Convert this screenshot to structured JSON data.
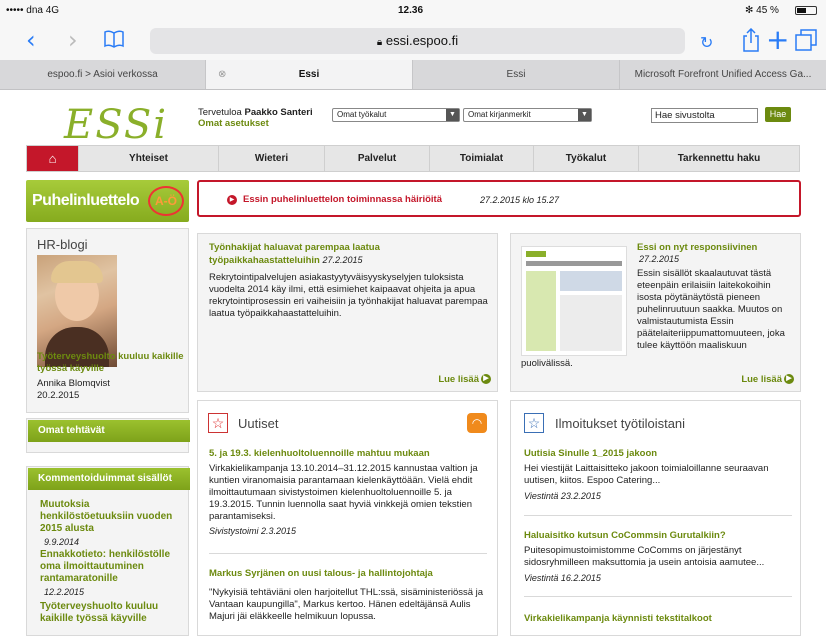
{
  "status": {
    "carrier": "••••• dna  4G",
    "time": "12.36",
    "battery": "✻ 45 %"
  },
  "browser": {
    "url": "essi.espoo.fi",
    "tabs": [
      {
        "label": "espoo.fi > Asioi verkossa"
      },
      {
        "label": "Essi",
        "close": "⊗"
      },
      {
        "label": "Essi"
      },
      {
        "label": "Microsoft Forefront Unified Access Ga..."
      }
    ]
  },
  "header": {
    "logo": "ESSi",
    "welcome": "Tervetuloa",
    "user": "Paakko Santeri",
    "settings": "Omat asetukset",
    "tools_select": "Omat työkalut",
    "bookmarks_select": "Omat kirjanmerkit",
    "search_value": "Hae sivustolta",
    "search_button": "Hae"
  },
  "nav": [
    "Yhteiset",
    "Wieteri",
    "Palvelut",
    "Toimialat",
    "Työkalut",
    "Tarkennettu haku"
  ],
  "phonebook": {
    "label": "Puhelinluettelo",
    "badge": "A-Ö"
  },
  "alert": {
    "text": "Essin puhelinluettelon toiminnassa häiriöitä",
    "date": "27.2.2015 klo 15.27"
  },
  "hrblog": {
    "title": "HR-blogi",
    "link": "Työterveyshuolto kuuluu kaikille työssä käyville",
    "author": "Annika Blomqvist",
    "date": "20.2.2015"
  },
  "sidebar": {
    "tasks": "Omat tehtävät",
    "commented": "Kommentoiduimmat sisällöt",
    "items": [
      {
        "title": "Muutoksia henkilöstöetuuksiin vuoden 2015 alusta",
        "date": "9.9.2014"
      },
      {
        "title": "Ennakkotieto: henkilöstölle oma ilmoittautuminen rantamaratonille",
        "date": "12.2.2015"
      },
      {
        "title": "Työterveyshuolto kuuluu kaikille työssä käyville",
        "date": ""
      }
    ]
  },
  "feature1": {
    "title": "Työnhakijat haluavat parempaa laatua työpaikkahaastatteluihin",
    "date": "27.2.2015",
    "body": "Rekrytointipalvelujen asiakastyytyväisyyskyselyjen tuloksista vuodelta 2014 käy ilmi, että esimiehet kaipaavat ohjeita ja apua rekrytointiprosessin eri vaiheisiin ja työnhakijat haluavat parempaa laatua työpaikkahaastatteluihin.",
    "more": "Lue lisää"
  },
  "feature2": {
    "title": "Essi on nyt responsiivinen",
    "date": "27.2.2015",
    "body": "Essin sisällöt skaalautuvat tästä eteenpäin erilaisiin laitekokoihin isosta pöytänäytöstä pieneen puhelinruutuun saakka. Muutos on valmistautumista Essin päätelaiteriippumattomuuteen, joka tulee käyttöön maaliskuun",
    "body2": "puolivälissä.",
    "more": "Lue lisää"
  },
  "news": {
    "heading": "Uutiset",
    "items": [
      {
        "title": "5. ja 19.3. kielenhuoltoluennoille mahtuu mukaan",
        "body": "Virkakielikampanja 13.10.2014–31.12.2015 kannustaa valtion ja kuntien viranomaisia parantamaan kielenkäyttöään. Vielä ehdit ilmoittautumaan sivistystoimen kielenhuoltoluennoille 5. ja 19.3.2015. Tunnin luennolla saat hyviä vinkkejä omien tekstien parantamiseksi.",
        "source": "Sivistystoimi 2.3.2015"
      },
      {
        "title": "Markus Syrjänen on uusi talous- ja hallintojohtaja",
        "body": "\"Nykyisiä tehtäviäni olen harjoitellut THL:ssä, sisäministeriössä ja Vantaan kaupungilla\", Markus kertoo. Hänen edeltäjänsä Aulis Majuri jäi eläkkeelle helmikuun lopussa.",
        "source": ""
      }
    ]
  },
  "notices": {
    "heading": "Ilmoitukset työtiloistani",
    "items": [
      {
        "title": "Uutisia Sinulle 1_2015 jakoon",
        "body": "Hei viestijät Laittaisitteko jakoon toimialoillanne seuraavan uutisen, kiitos. Espoo Catering...",
        "source": "Viestintä 23.2.2015"
      },
      {
        "title": "Haluaisitko kutsun CoCommsin Gurutalkiin?",
        "body": "Puitesopimustoimistomme CoComms on järjestänyt sidosryhmilleen maksuttomia ja usein antoisia aamutee...",
        "source": "Viestintä 16.2.2015"
      },
      {
        "title": "Virkakielikampanja käynnisti tekstitalkoot",
        "body": "",
        "source": ""
      }
    ]
  }
}
